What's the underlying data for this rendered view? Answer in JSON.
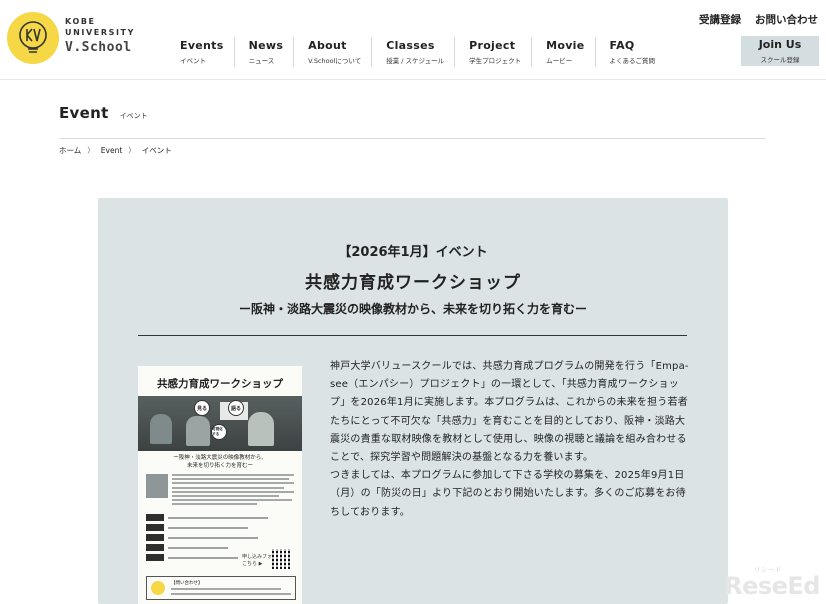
{
  "brand": {
    "line1": "KOBE",
    "line2": "UNIVERSITY",
    "line3": "V.School",
    "colors": {
      "logo_bg": "#f6d846",
      "panel_bg": "#dbe3e4",
      "join_bg": "#d4dde0"
    }
  },
  "util_links": [
    {
      "label": "受講登録"
    },
    {
      "label": "お問い合わせ"
    }
  ],
  "nav": [
    {
      "en": "Events",
      "ja": "イベント"
    },
    {
      "en": "News",
      "ja": "ニュース"
    },
    {
      "en": "About",
      "ja": "V.Schoolについて"
    },
    {
      "en": "Classes",
      "ja": "授業 / スケジュール"
    },
    {
      "en": "Project",
      "ja": "学生プロジェクト"
    },
    {
      "en": "Movie",
      "ja": "ムービー"
    },
    {
      "en": "FAQ",
      "ja": "よくあるご質問"
    }
  ],
  "join": {
    "en": "Join Us",
    "ja": "スクール登録"
  },
  "page": {
    "title": "Event",
    "subtitle": "イベント"
  },
  "breadcrumb": {
    "home": "ホーム",
    "event": "Event",
    "current": "イベント",
    "sep": "〉"
  },
  "article": {
    "tag": "【2026年1月】イベント",
    "title": "共感力育成ワークショップ",
    "subtitle": "ー阪神・淡路大震災の映像教材から、未来を切り拓く力を育むー",
    "paragraph1": "神戸大学バリュースクールでは、共感力育成プログラムの開発を行う「Empa-see（エンパシー）プロジェクト」の一環として、「共感力育成ワークショップ」を2026年1月に実施します。本プログラムは、これからの未来を担う若者たちにとって不可欠な「共感力」を育むことを目的としており、阪神・淡路大震災の貴重な取材映像を教材として使用し、映像の視聴と議論を組み合わせることで、探究学習や問題解決の基盤となる力を養います。",
    "paragraph2": "つきましては、本プログラムに参加して下さる学校の募集を、2025年9月1日（月）の「防災の日」より下記のとおり開始いたします。多くのご応募をお待ちしております。"
  },
  "flyer": {
    "title": "共感力育成ワークショップ",
    "circles": [
      "見る",
      "語る",
      "可視化する"
    ],
    "caption_line1": "ー阪神・淡路大震災の映像教材から、",
    "caption_line2": "未来を切り拓く力を育むー",
    "apply_text_1": "申し込みフォームは",
    "apply_text_2": "こちら ▶",
    "contact": "【問い合わせ】"
  },
  "watermark": {
    "text": "ReseEd",
    "ruby": "リシード"
  }
}
